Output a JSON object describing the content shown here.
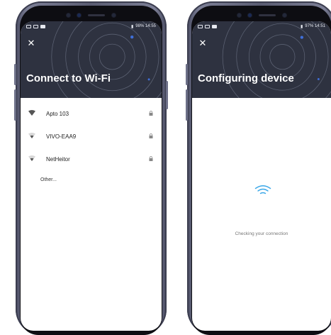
{
  "colors": {
    "header_bg": "#2e3240",
    "accent_wifi": "#3aa7e8",
    "text_dark": "#222222",
    "text_muted": "#777777"
  },
  "left_phone": {
    "status_bar": {
      "right_text": "98% 14:55"
    },
    "close_icon": "close-icon",
    "title": "Connect to Wi-Fi",
    "networks": [
      {
        "name": "Apto 103",
        "icon": "wifi-strong-icon",
        "secured": true
      },
      {
        "name": "VIVO-EAA9",
        "icon": "wifi-weak-icon",
        "secured": true
      },
      {
        "name": "NetHeitor",
        "icon": "wifi-weak-icon",
        "secured": true
      }
    ],
    "other_label": "Other..."
  },
  "right_phone": {
    "status_bar": {
      "right_text": "97% 14:51"
    },
    "close_icon": "close-icon",
    "title": "Configuring device",
    "status_text": "Checking your connection",
    "center_icon": "wifi-icon"
  }
}
